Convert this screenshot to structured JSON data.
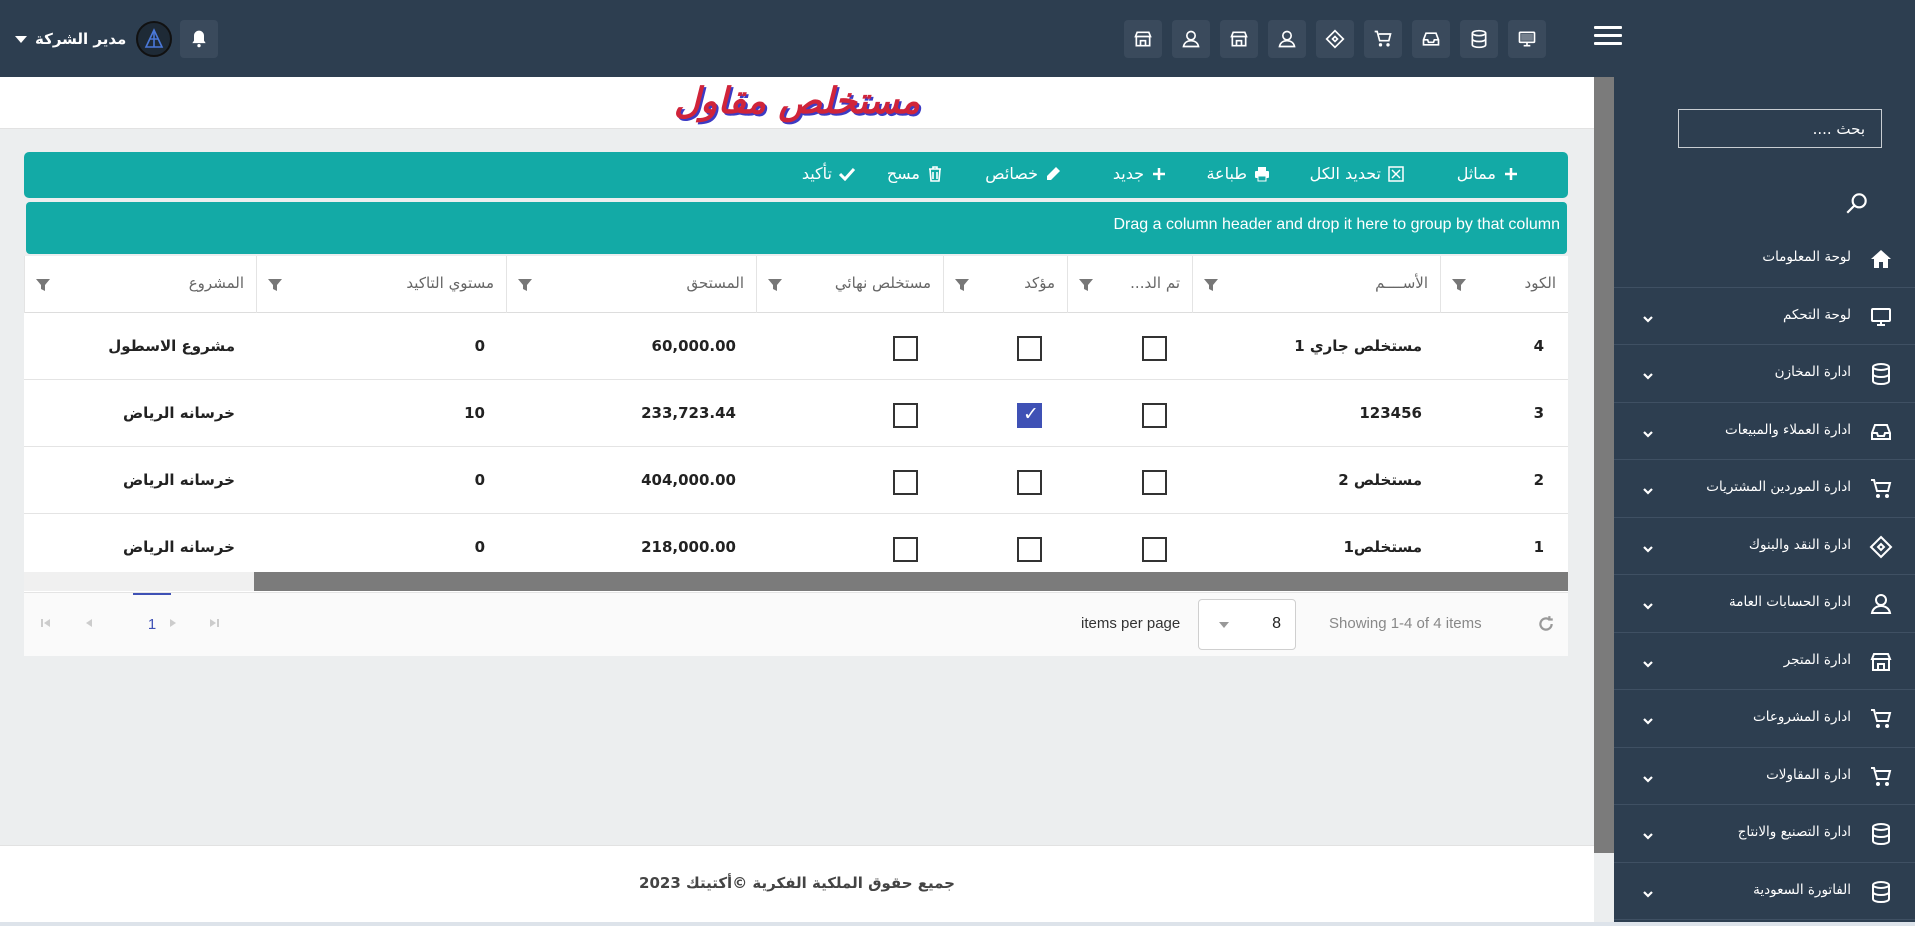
{
  "header": {
    "user_name": "مدير الشركة",
    "icons": [
      "monitor-icon",
      "database-icon",
      "inbox-icon",
      "cart-icon",
      "tag-icon",
      "user-icon",
      "store-icon",
      "user-icon",
      "store-icon"
    ]
  },
  "sidebar": {
    "search_placeholder": "بحث ....",
    "items": [
      {
        "label": "لوحة المعلومات",
        "icon": "home-icon",
        "has_submenu": false
      },
      {
        "label": "لوحة التحكم",
        "icon": "monitor-icon",
        "has_submenu": true
      },
      {
        "label": "ادارة المخازن",
        "icon": "database-icon",
        "has_submenu": true
      },
      {
        "label": "ادارة العملاء والمبيعات",
        "icon": "inbox-icon",
        "has_submenu": true
      },
      {
        "label": "ادارة الموردين المشتريات",
        "icon": "cart-icon",
        "has_submenu": true
      },
      {
        "label": "ادارة النقد والبنوك",
        "icon": "tag-icon",
        "has_submenu": true
      },
      {
        "label": "ادارة الحسابات العامة",
        "icon": "user-icon",
        "has_submenu": true
      },
      {
        "label": "ادارة المتجر",
        "icon": "store-icon",
        "has_submenu": true
      },
      {
        "label": "ادارة المشروعات",
        "icon": "cart-icon",
        "has_submenu": true
      },
      {
        "label": "ادارة المقاولات",
        "icon": "cart-icon",
        "has_submenu": true
      },
      {
        "label": "ادارة التصنيع والانتاج",
        "icon": "database-icon",
        "has_submenu": true
      },
      {
        "label": "الفاتورة السعودية",
        "icon": "database-icon",
        "has_submenu": true
      }
    ]
  },
  "page": {
    "title": "مستخلص مقاول"
  },
  "toolbar": {
    "similar": "مماثل",
    "select_all": "تحديد الكل",
    "print": "طباعة",
    "new": "جديد",
    "properties": "خصائص",
    "delete": "مسح",
    "confirm": "تأكيد"
  },
  "grid": {
    "group_panel_text": "Drag a column header and drop it here to group by that column",
    "columns": {
      "code": "الكود",
      "name": "الأســــم",
      "done": "تم الد...",
      "confirmed": "مؤكد",
      "final": "مستخلص نهائي",
      "due": "المستحق",
      "confirm_level": "مستوي التاكيد",
      "project": "المشروع"
    },
    "rows": [
      {
        "code": "4",
        "name": "مستخلص جاري 1",
        "done": false,
        "confirmed": false,
        "final": false,
        "due": "60,000.00",
        "confirm_level": "0",
        "project": "مشروع الاسطول"
      },
      {
        "code": "3",
        "name": "123456",
        "done": false,
        "confirmed": true,
        "final": false,
        "due": "233,723.44",
        "confirm_level": "10",
        "project": "خرسانه الرياض"
      },
      {
        "code": "2",
        "name": "مستخلص 2",
        "done": false,
        "confirmed": false,
        "final": false,
        "due": "404,000.00",
        "confirm_level": "0",
        "project": "خرسانه الرياض"
      },
      {
        "code": "1",
        "name": "مستخلص1",
        "done": false,
        "confirmed": false,
        "final": false,
        "due": "218,000.00",
        "confirm_level": "0",
        "project": "خرسانه الرياض"
      }
    ]
  },
  "pager": {
    "current_page": "1",
    "items_per_page_label": "items per page",
    "items_per_page": "8",
    "showing": "Showing 1-4 of 4 items"
  },
  "footer": {
    "text": "جميع حقوق الملكية الفكرية ©أكتيتك 2023"
  },
  "colors": {
    "topbar": "#2d3e50",
    "toolbar": "#13aaa6",
    "title": "#d0243a",
    "checkbox_checked": "#3f51b5"
  }
}
